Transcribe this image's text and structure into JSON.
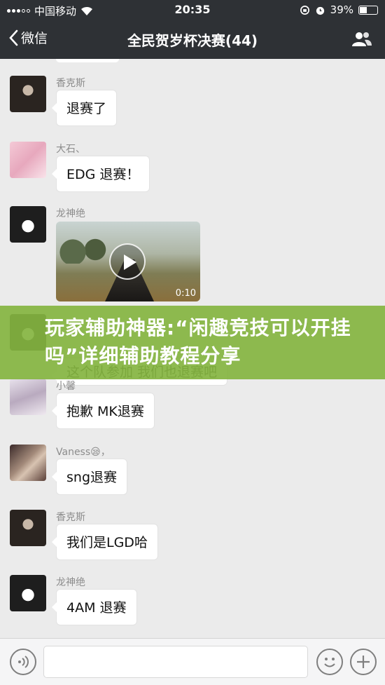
{
  "statusbar": {
    "carrier": "中国移动",
    "time": "20:35",
    "battery": "39%"
  },
  "navbar": {
    "back_label": "微信",
    "title": "全民贺岁杯决赛(44)"
  },
  "messages": [
    {
      "sender": "香克斯",
      "text": "退赛了"
    },
    {
      "sender": "大石、",
      "text": "EDG 退赛！"
    },
    {
      "sender": "龙神绝",
      "video_duration": "0:10"
    },
    {
      "sender": "小馨",
      "text": "抱歉 MK退赛"
    },
    {
      "sender": "Vaness😪，",
      "text": "sng退赛"
    },
    {
      "sender": "香克斯",
      "text": "我们是LGD哈"
    },
    {
      "sender": "龙神绝",
      "text": "4AM 退赛"
    }
  ],
  "hidden_message_fragment": "这个队参加 我们也退赛吧",
  "overlay": {
    "text": "玩家辅助神器:“闲趣竞技可以开挂吗”详细辅助教程分享"
  },
  "colors": {
    "navbar_bg": "#2e3135",
    "chat_bg": "#ebebeb",
    "overlay_bg": "#84b440"
  }
}
